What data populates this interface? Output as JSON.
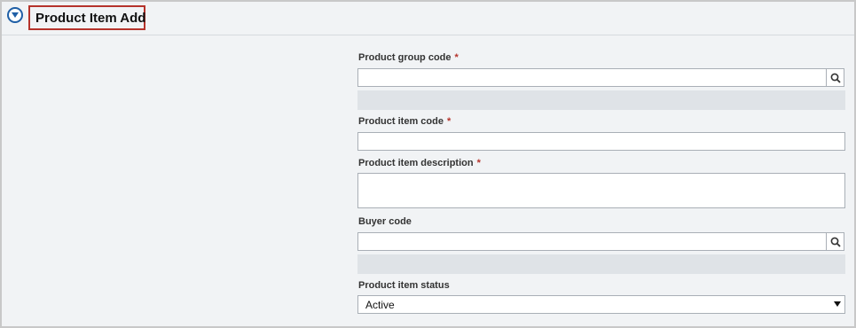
{
  "header": {
    "title": "Product Item Add",
    "collapse_icon": "chevron-down-circle-icon"
  },
  "form": {
    "product_group_code": {
      "label": "Product group code",
      "required": "*",
      "value": "",
      "search_icon": "search-icon"
    },
    "product_item_code": {
      "label": "Product item code",
      "required": "*",
      "value": ""
    },
    "product_item_description": {
      "label": "Product item description",
      "required": "*",
      "value": ""
    },
    "buyer_code": {
      "label": "Buyer code",
      "value": "",
      "search_icon": "search-icon"
    },
    "product_item_status": {
      "label": "Product item status",
      "selected": "Active"
    }
  },
  "colors": {
    "accent": "#1f5fa6",
    "required": "#b5332b",
    "panel_bg": "#f1f3f5",
    "readonly_bg": "#dfe3e7"
  }
}
